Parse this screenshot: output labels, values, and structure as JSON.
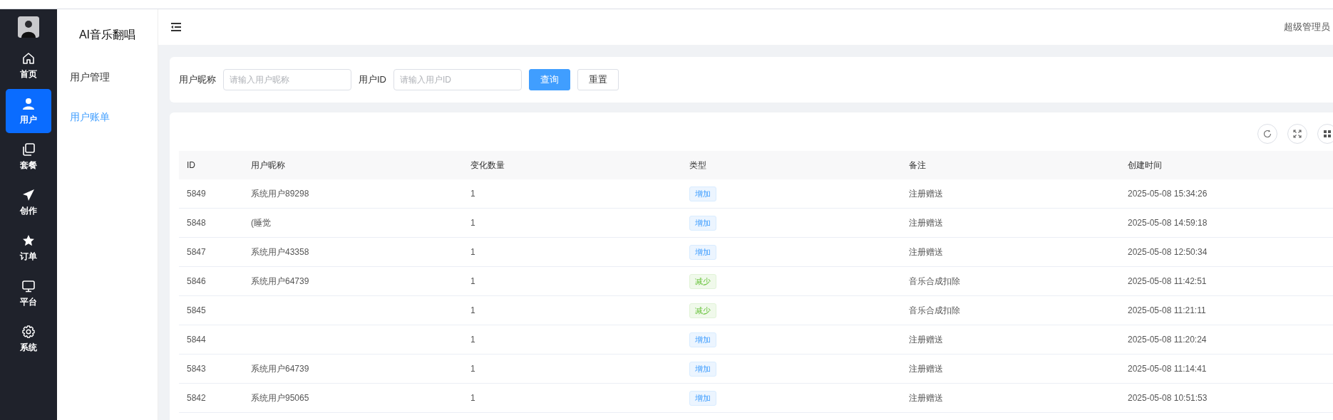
{
  "nav": [
    {
      "label": "首页",
      "kind": "home",
      "selected": false
    },
    {
      "label": "用户",
      "kind": "user",
      "selected": true
    },
    {
      "label": "套餐",
      "kind": "copy",
      "selected": false
    },
    {
      "label": "创作",
      "kind": "send",
      "selected": false
    },
    {
      "label": "订单",
      "kind": "star",
      "selected": false
    },
    {
      "label": "平台",
      "kind": "monitor",
      "selected": false
    },
    {
      "label": "系统",
      "kind": "gear",
      "selected": false
    }
  ],
  "app_title": "AI音乐翻唱",
  "submenu": [
    {
      "label": "用户管理",
      "selected": false
    },
    {
      "label": "用户账单",
      "selected": true
    }
  ],
  "header": {
    "user": "超级管理员"
  },
  "search": {
    "fields": [
      {
        "label": "用户昵称",
        "placeholder": "请输入用户昵称"
      },
      {
        "label": "用户ID",
        "placeholder": "请输入用户ID"
      }
    ],
    "buttons": [
      {
        "label": "查询",
        "kind": "primary"
      },
      {
        "label": "重置",
        "kind": "default"
      }
    ]
  },
  "table": {
    "columns": [
      "ID",
      "用户昵称",
      "变化数量",
      "类型",
      "备注",
      "创建时间"
    ],
    "rows": [
      {
        "id": "5849",
        "nickname": "系统用户89298",
        "amount": "1",
        "type": {
          "label": "增加",
          "kind": "increase"
        },
        "remark": "注册赠送",
        "created": "2025-05-08 15:34:26"
      },
      {
        "id": "5848",
        "nickname": "(睡觉",
        "amount": "1",
        "type": {
          "label": "增加",
          "kind": "increase"
        },
        "remark": "注册赠送",
        "created": "2025-05-08 14:59:18"
      },
      {
        "id": "5847",
        "nickname": "系统用户43358",
        "amount": "1",
        "type": {
          "label": "增加",
          "kind": "increase"
        },
        "remark": "注册赠送",
        "created": "2025-05-08 12:50:34"
      },
      {
        "id": "5846",
        "nickname": "系统用户64739",
        "amount": "1",
        "type": {
          "label": "减少",
          "kind": "decrease"
        },
        "remark": "音乐合成扣除",
        "created": "2025-05-08 11:42:51"
      },
      {
        "id": "5845",
        "amount": "1",
        "type": {
          "label": "减少",
          "kind": "decrease"
        },
        "remark": "音乐合成扣除",
        "created": "2025-05-08 11:21:11"
      },
      {
        "id": "5844",
        "amount": "1",
        "type": {
          "label": "增加",
          "kind": "increase"
        },
        "remark": "注册赠送",
        "created": "2025-05-08 11:20:24"
      },
      {
        "id": "5843",
        "nickname": "系统用户64739",
        "amount": "1",
        "type": {
          "label": "增加",
          "kind": "increase"
        },
        "remark": "注册赠送",
        "created": "2025-05-08 11:14:41"
      },
      {
        "id": "5842",
        "nickname": "系统用户95065",
        "amount": "1",
        "type": {
          "label": "增加",
          "kind": "increase"
        },
        "remark": "注册赠送",
        "created": "2025-05-08 10:51:53"
      }
    ]
  }
}
